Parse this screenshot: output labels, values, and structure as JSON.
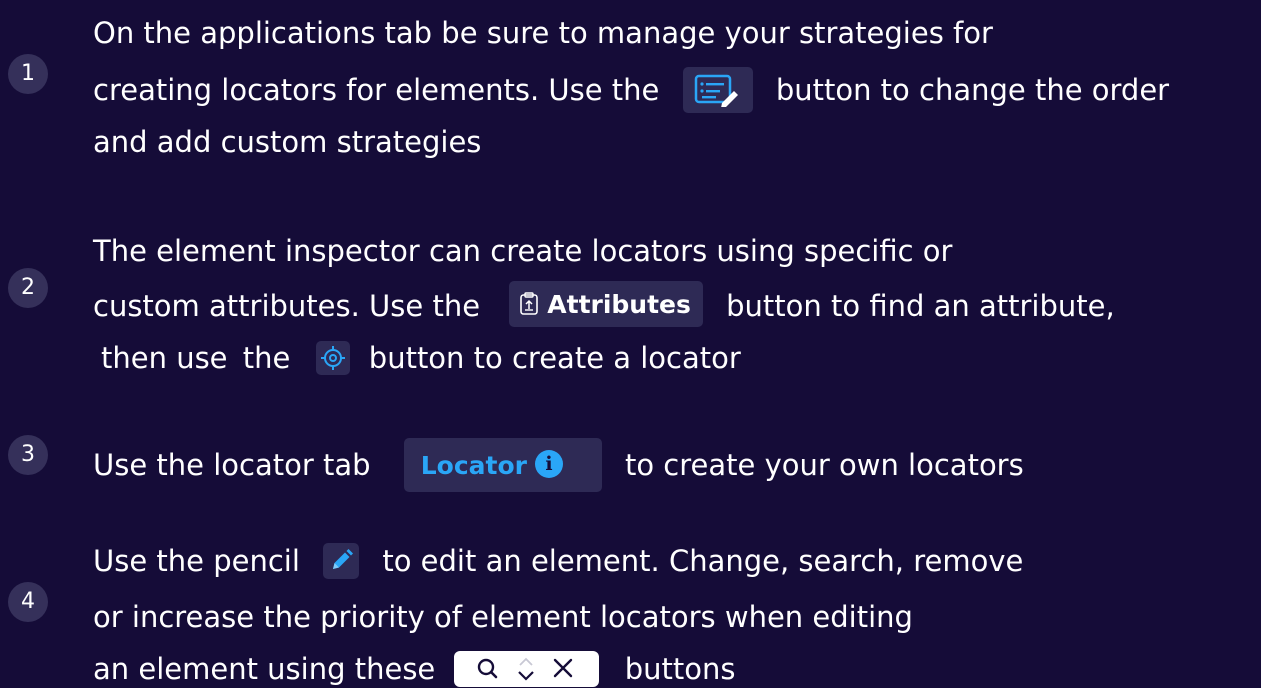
{
  "steps": [
    {
      "number": "1",
      "lines": [
        "On the applications tab be sure to manage your strategies for",
        "creating locators for elements. Use the",
        "button to change the order",
        "and add custom strategies"
      ]
    },
    {
      "number": "2",
      "lines": [
        "The element inspector can create locators using specific or",
        "custom attributes. Use the",
        "button to find an attribute,",
        "then use",
        "the",
        "button to create a locator"
      ],
      "attributes_label": "Attributes"
    },
    {
      "number": "3",
      "lines": [
        "Use the locator tab",
        "to create your own locators"
      ],
      "locator_label": "Locator",
      "info_glyph": "i"
    },
    {
      "number": "4",
      "lines": [
        "Use the pencil",
        "to edit an element. Change, search, remove",
        "or increase the priority of element locators when editing",
        "an element using these",
        "buttons"
      ]
    }
  ],
  "icons": {
    "strategy_button": "list-edit-icon",
    "attributes_button": "clipboard-upload-icon",
    "target_button": "crosshair-target-icon",
    "info_badge": "info-icon",
    "pencil_button": "pencil-icon",
    "edit_buttons": [
      "search-icon",
      "chevron-up-down-icon",
      "close-icon"
    ]
  },
  "colors": {
    "background": "#150c38",
    "badge": "#35305a",
    "button_bg": "#2e2a55",
    "accent_blue": "#2aa6f7",
    "text": "#ffffff"
  }
}
